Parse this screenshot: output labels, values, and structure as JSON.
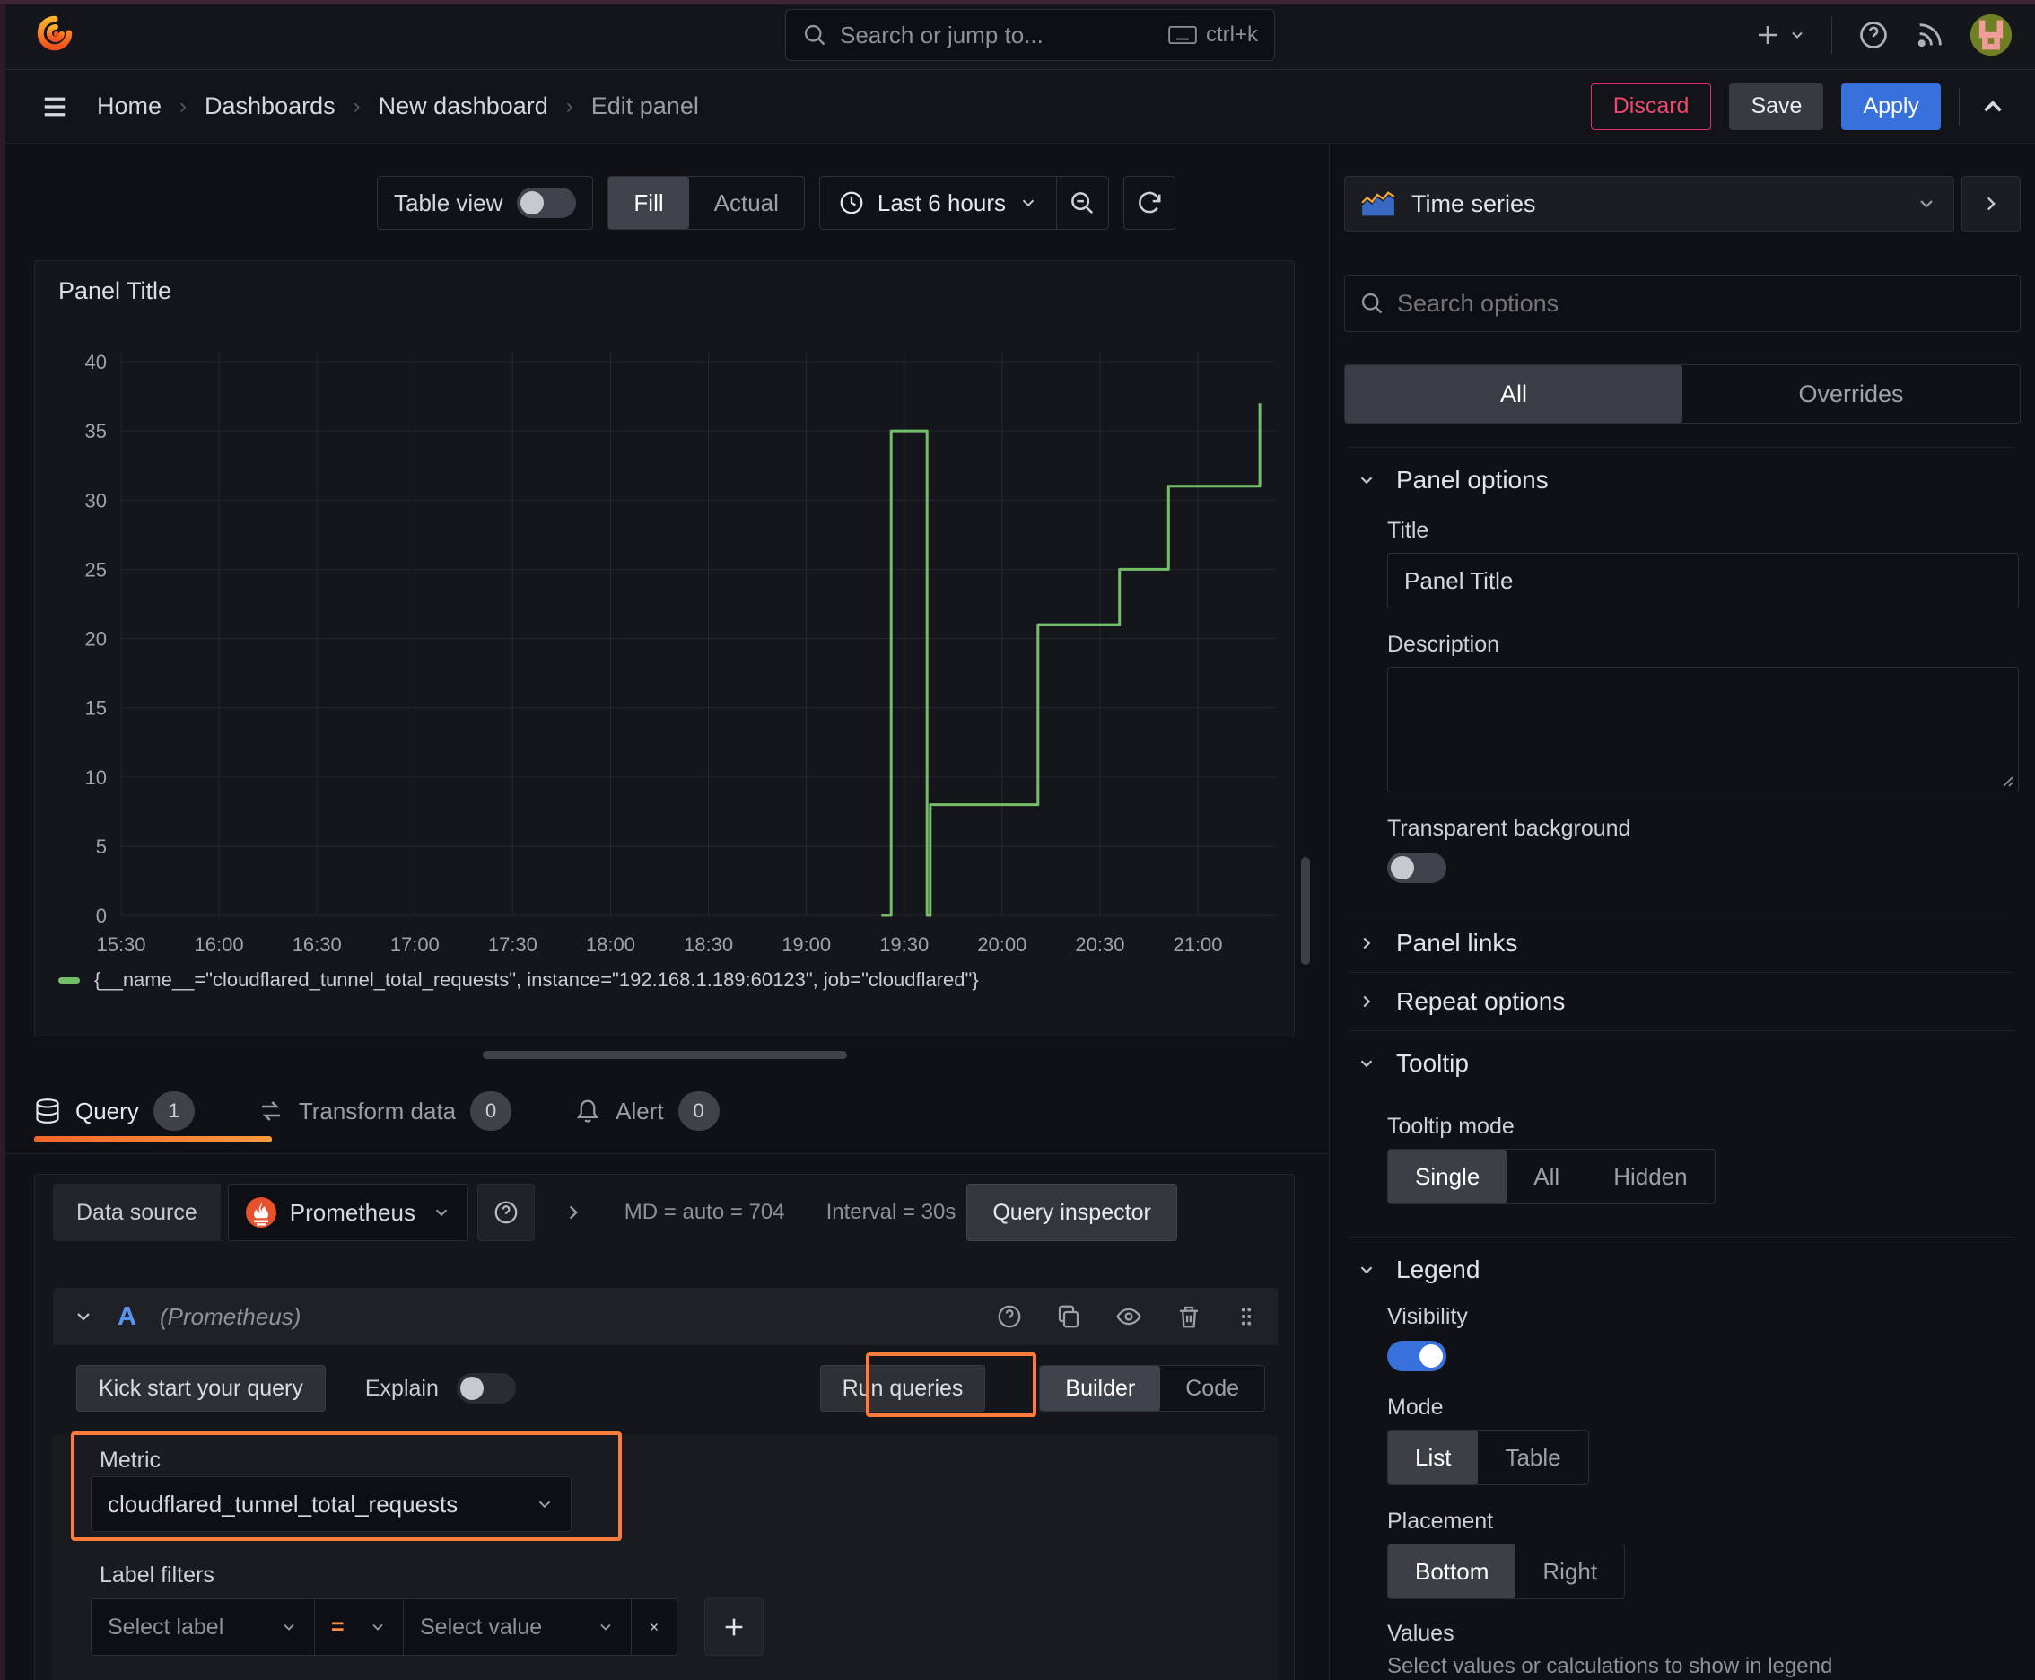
{
  "topnav": {
    "search_placeholder": "Search or jump to...",
    "search_shortcut": "ctrl+k"
  },
  "breadcrumb": {
    "items": [
      "Home",
      "Dashboards",
      "New dashboard",
      "Edit panel"
    ]
  },
  "header_actions": {
    "discard": "Discard",
    "save": "Save",
    "apply": "Apply"
  },
  "toolbar": {
    "table_view_label": "Table view",
    "fill": "Fill",
    "actual": "Actual",
    "time_range": "Last 6 hours"
  },
  "panel": {
    "title": "Panel Title",
    "legend": "{__name__=\"cloudflared_tunnel_total_requests\", instance=\"192.168.1.189:60123\", job=\"cloudflared\"}"
  },
  "chart_data": {
    "type": "line",
    "line_style": "step-after",
    "title": "Panel Title",
    "xlabel": "time",
    "ylabel": "",
    "ylim": [
      0,
      40
    ],
    "xlim": [
      "15:30",
      "21:23"
    ],
    "grid": true,
    "legend_position": "bottom",
    "y_ticks": [
      0,
      5,
      10,
      15,
      20,
      25,
      30,
      35,
      40
    ],
    "x_ticks": [
      "15:30",
      "16:00",
      "16:30",
      "17:00",
      "17:30",
      "18:00",
      "18:30",
      "19:00",
      "19:30",
      "20:00",
      "20:30",
      "21:00"
    ],
    "series": [
      {
        "name": "{__name__=\"cloudflared_tunnel_total_requests\", instance=\"192.168.1.189:60123\", job=\"cloudflared\"}",
        "color": "#73bf69",
        "points": [
          [
            "19:23",
            0
          ],
          [
            "19:26",
            35
          ],
          [
            "19:37",
            0
          ],
          [
            "19:38",
            8
          ],
          [
            "20:11",
            21
          ],
          [
            "20:36",
            25
          ],
          [
            "20:51",
            31
          ],
          [
            "21:19",
            37
          ]
        ]
      }
    ]
  },
  "tabs": {
    "query": {
      "label": "Query",
      "count": "1"
    },
    "transform": {
      "label": "Transform data",
      "count": "0"
    },
    "alert": {
      "label": "Alert",
      "count": "0"
    }
  },
  "query_section": {
    "datasource_label": "Data source",
    "datasource_value": "Prometheus",
    "stats_md": "MD = auto = 704",
    "stats_interval": "Interval = 30s",
    "inspector": "Query inspector",
    "row": {
      "ref_id": "A",
      "ds_hint": "(Prometheus)"
    },
    "kick_start": "Kick start your query",
    "explain": "Explain",
    "run_queries": "Run queries",
    "builder": "Builder",
    "code": "Code",
    "metric": {
      "label": "Metric",
      "value": "cloudflared_tunnel_total_requests"
    },
    "label_filters": {
      "label": "Label filters",
      "select_label": "Select label",
      "operator": "=",
      "select_value": "Select value"
    }
  },
  "options_pane": {
    "viz_type": "Time series",
    "search_placeholder": "Search options",
    "tabs": {
      "all": "All",
      "overrides": "Overrides"
    },
    "panel_options": {
      "title": "Panel options",
      "title_label": "Title",
      "title_value": "Panel Title",
      "description_label": "Description",
      "transparent_label": "Transparent background",
      "links": "Panel links",
      "repeat": "Repeat options"
    },
    "tooltip": {
      "title": "Tooltip",
      "mode_label": "Tooltip mode",
      "modes": [
        "Single",
        "All",
        "Hidden"
      ],
      "selected": "Single"
    },
    "legend": {
      "title": "Legend",
      "visibility_label": "Visibility",
      "mode_label": "Mode",
      "modes": [
        "List",
        "Table"
      ],
      "selected_mode": "List",
      "placement_label": "Placement",
      "placements": [
        "Bottom",
        "Right"
      ],
      "selected_placement": "Bottom",
      "values_label": "Values",
      "values_hint": "Select values or calculations to show in legend"
    }
  },
  "colors": {
    "accent_orange": "#ff7c3b",
    "brand_blue": "#3871dc",
    "series_green": "#73bf69",
    "danger_pink": "#e0316a"
  }
}
